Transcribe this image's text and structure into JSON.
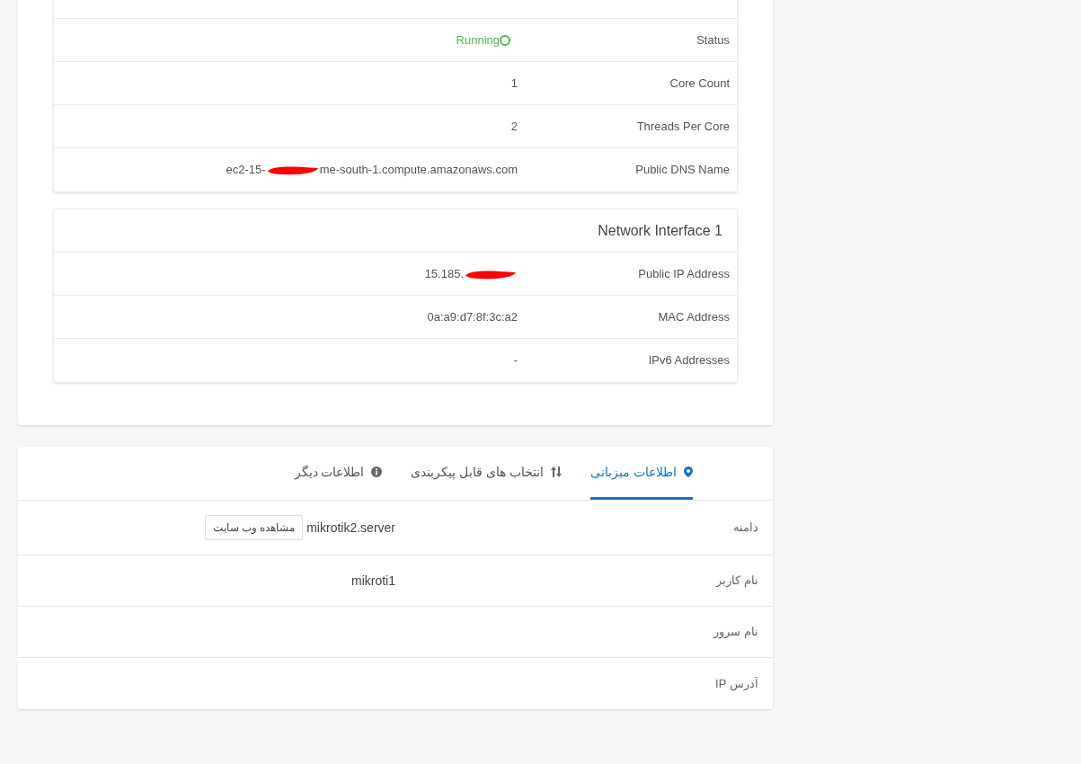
{
  "instance_details": {
    "rows": [
      {
        "label": "Status",
        "kind": "status",
        "value": "Running"
      },
      {
        "label": "Core Count",
        "kind": "text",
        "value": "1"
      },
      {
        "label": "Threads Per Core",
        "kind": "text",
        "value": "2"
      },
      {
        "label": "Public DNS Name",
        "kind": "redacted",
        "value": "ec2-15-",
        "value_end": "me-south-1.compute.amazonaws.com"
      }
    ]
  },
  "network_interface": {
    "title": "Network Interface 1",
    "rows": [
      {
        "label": "Public IP Address",
        "kind": "redacted",
        "value": "15.185."
      },
      {
        "label": "MAC Address",
        "kind": "text",
        "value": "0a:a9:d7:8f:3c:a2"
      },
      {
        "label": "IPv6 Addresses",
        "kind": "text",
        "value": "-"
      }
    ]
  },
  "hosting_panel": {
    "tabs": [
      {
        "label": "اطلاعات میزبانی",
        "kind": "pin",
        "selected": true
      },
      {
        "label": "انتخاب های قابل پیکربندی",
        "kind": "sliders",
        "selected": false
      },
      {
        "label": "اطلاعات دیگر",
        "kind": "info",
        "selected": false
      }
    ],
    "rows": [
      {
        "label": "دامنه",
        "value": "mikrotik2.server",
        "button": "مشاهده وب سایت"
      },
      {
        "label": "نام کاربر",
        "value": "mikroti1"
      },
      {
        "label": "نام سرور"
      },
      {
        "label": "آدرس IP"
      }
    ]
  }
}
